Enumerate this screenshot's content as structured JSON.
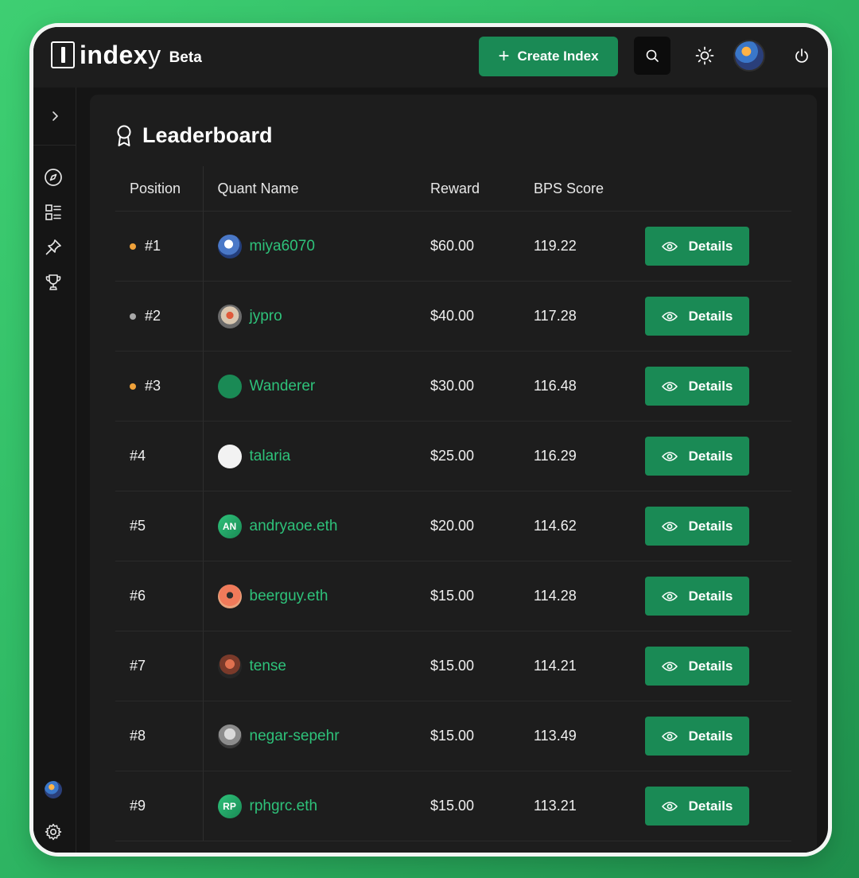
{
  "header": {
    "logo_text": "index",
    "logo_y": "y",
    "beta_label": "Beta",
    "create_label": "Create Index"
  },
  "page": {
    "title": "Leaderboard"
  },
  "table": {
    "columns": [
      "Position",
      "Quant Name",
      "Reward",
      "BPS Score"
    ],
    "action_label": "Details",
    "rows": [
      {
        "position": "#1",
        "name": "miya6070",
        "reward": "$60.00",
        "bps": "119.22",
        "dot": "#f0a23a",
        "avatar_initials": ""
      },
      {
        "position": "#2",
        "name": "jypro",
        "reward": "$40.00",
        "bps": "117.28",
        "dot": "#a8a8a8",
        "avatar_initials": ""
      },
      {
        "position": "#3",
        "name": "Wanderer",
        "reward": "$30.00",
        "bps": "116.48",
        "dot": "#f0a23a",
        "avatar_initials": ""
      },
      {
        "position": "#4",
        "name": "talaria",
        "reward": "$25.00",
        "bps": "116.29",
        "dot": "",
        "avatar_initials": ""
      },
      {
        "position": "#5",
        "name": "andryaoe.eth",
        "reward": "$20.00",
        "bps": "114.62",
        "dot": "",
        "avatar_initials": "AN"
      },
      {
        "position": "#6",
        "name": "beerguy.eth",
        "reward": "$15.00",
        "bps": "114.28",
        "dot": "",
        "avatar_initials": ""
      },
      {
        "position": "#7",
        "name": "tense",
        "reward": "$15.00",
        "bps": "114.21",
        "dot": "",
        "avatar_initials": ""
      },
      {
        "position": "#8",
        "name": "negar-sepehr",
        "reward": "$15.00",
        "bps": "113.49",
        "dot": "",
        "avatar_initials": ""
      },
      {
        "position": "#9",
        "name": "rphgrc.eth",
        "reward": "$15.00",
        "bps": "113.21",
        "dot": "",
        "avatar_initials": "RP"
      }
    ]
  },
  "icons": {
    "search": "search-icon",
    "theme": "sun-icon",
    "power": "power-icon",
    "sidebar": [
      "chevron-right-icon",
      "compass-icon",
      "list-icon",
      "pin-icon",
      "trophy-icon",
      "settings-icon"
    ],
    "title": "award-icon",
    "details": "eye-icon"
  },
  "colors": {
    "accent": "#1a8a55",
    "link": "#2ec27a",
    "background": "#151515",
    "panel": "#1d1d1d"
  }
}
